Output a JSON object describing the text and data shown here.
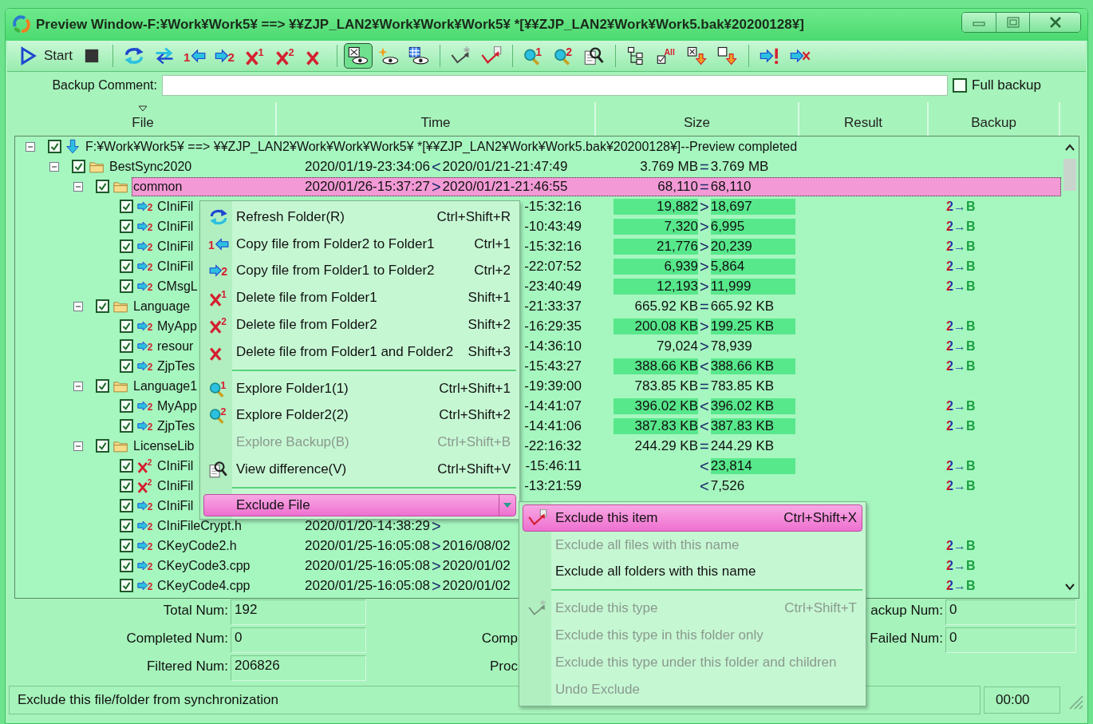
{
  "window": {
    "title": "Preview Window-F:¥Work¥Work5¥ ==> ¥¥ZJP_LAN2¥Work¥Work¥Work5¥ *[¥¥ZJP_LAN2¥Work¥Work5.bak¥20200128¥]"
  },
  "toolbar": [
    {
      "kind": "start",
      "label": "Start"
    },
    {
      "kind": "stop"
    },
    {
      "kind": "separator"
    },
    {
      "kind": "refresh"
    },
    {
      "kind": "sync"
    },
    {
      "kind": "copy_left",
      "badge": "1"
    },
    {
      "kind": "copy_right",
      "badge": "2"
    },
    {
      "kind": "delete",
      "badge": "1"
    },
    {
      "kind": "delete",
      "badge": "2"
    },
    {
      "kind": "delete"
    },
    {
      "kind": "separator"
    },
    {
      "kind": "view",
      "pressed": true
    },
    {
      "kind": "view_spark",
      "pressed": false
    },
    {
      "kind": "view_grid",
      "pressed": false
    },
    {
      "kind": "separator"
    },
    {
      "kind": "exclude_type"
    },
    {
      "kind": "exclude"
    },
    {
      "kind": "separator"
    },
    {
      "kind": "explore",
      "badge": "1"
    },
    {
      "kind": "explore",
      "badge": "2"
    },
    {
      "kind": "diff"
    },
    {
      "kind": "separator"
    },
    {
      "kind": "tree"
    },
    {
      "kind": "check_all",
      "badge": "All"
    },
    {
      "kind": "check_down"
    },
    {
      "kind": "uncheck_down"
    },
    {
      "kind": "separator"
    },
    {
      "kind": "arrow_alert"
    },
    {
      "kind": "arrow_cancel"
    }
  ],
  "backup_comment": {
    "label": "Backup Comment:",
    "full_backup": {
      "label": "Full backup",
      "checked": false
    }
  },
  "columns": [
    "File",
    "Time",
    "Size",
    "Result",
    "Backup"
  ],
  "tree": [
    {
      "kind": "root",
      "name": "F:¥Work¥Work5¥ ==> ¥¥ZJP_LAN2¥Work¥Work¥Work5¥ *[¥¥ZJP_LAN2¥Work¥Work5.bak¥20200128¥]--Preview completed",
      "checked": true,
      "expanded": true,
      "selected": false,
      "children": [
        {
          "kind": "folder",
          "name": "BestSync2020",
          "checked": true,
          "expanded": true,
          "selected": false,
          "time1": "2020/01/19-23:34:06",
          "time_cmp": "<",
          "time2": "2020/01/21-21:47:49",
          "size1": "3.769 MB",
          "size_cmp": "=",
          "size2": "3.769 MB",
          "highlight": false,
          "children": [
            {
              "kind": "folder",
              "name": "common",
              "checked": true,
              "expanded": true,
              "selected": true,
              "time1": "2020/01/26-15:37:27",
              "time_cmp": ">",
              "time2": "2020/01/21-21:46:55",
              "size1": "68,110",
              "size_cmp": "=",
              "size2": "68,110",
              "highlight": false,
              "children": [
                {
                  "kind": "copy",
                  "icon_badge": "2",
                  "name": "CIniFil",
                  "checked": true,
                  "selected": false,
                  "time2": "-15:32:16",
                  "size1": "19,882",
                  "size_cmp": ">",
                  "size2": "18,697",
                  "highlight": true,
                  "backup": "2→B"
                },
                {
                  "kind": "copy",
                  "icon_badge": "2",
                  "name": "CIniFil",
                  "checked": true,
                  "selected": false,
                  "time2": "-10:43:49",
                  "size1": "7,320",
                  "size_cmp": ">",
                  "size2": "6,995",
                  "highlight": true,
                  "backup": "2→B"
                },
                {
                  "kind": "copy",
                  "icon_badge": "2",
                  "name": "CIniFil",
                  "checked": true,
                  "selected": false,
                  "time2": "-15:32:16",
                  "size1": "21,776",
                  "size_cmp": ">",
                  "size2": "20,239",
                  "highlight": true,
                  "backup": "2→B"
                },
                {
                  "kind": "copy",
                  "icon_badge": "2",
                  "name": "CIniFil",
                  "checked": true,
                  "selected": false,
                  "time2": "-22:07:52",
                  "size1": "6,939",
                  "size_cmp": ">",
                  "size2": "5,864",
                  "highlight": true,
                  "backup": "2→B"
                },
                {
                  "kind": "copy",
                  "icon_badge": "2",
                  "name": "CMsgL",
                  "checked": true,
                  "selected": false,
                  "time2": "-23:40:49",
                  "size1": "12,193",
                  "size_cmp": ">",
                  "size2": "11,999",
                  "highlight": true,
                  "backup": "2→B"
                }
              ]
            },
            {
              "kind": "folder",
              "name": "Language",
              "checked": true,
              "expanded": true,
              "selected": false,
              "time2": "-21:33:37",
              "size1": "665.92 KB",
              "size_cmp": "=",
              "size2": "665.92 KB",
              "highlight": false,
              "children": [
                {
                  "kind": "copy",
                  "icon_badge": "2",
                  "name": "MyApp",
                  "checked": true,
                  "selected": false,
                  "time2": "-16:29:35",
                  "size1": "200.08 KB",
                  "size_cmp": ">",
                  "size2": "199.25 KB",
                  "highlight": true,
                  "backup": "2→B"
                },
                {
                  "kind": "copy",
                  "icon_badge": "2",
                  "name": "resour",
                  "checked": true,
                  "selected": false,
                  "time2": "-14:36:10",
                  "size1": "79,024",
                  "size_cmp": ">",
                  "size2": "78,939",
                  "highlight": false,
                  "backup": "2→B"
                },
                {
                  "kind": "copy",
                  "icon_badge": "2",
                  "name": "ZjpTes",
                  "checked": true,
                  "selected": false,
                  "time2": "-15:43:27",
                  "size1": "388.66 KB",
                  "size_cmp": "<",
                  "size2": "388.66 KB",
                  "highlight": true,
                  "backup": "2→B"
                }
              ]
            },
            {
              "kind": "folder",
              "name": "Language1",
              "checked": true,
              "expanded": true,
              "selected": false,
              "time2": "-19:39:00",
              "size1": "783.85 KB",
              "size_cmp": "=",
              "size2": "783.85 KB",
              "highlight": false,
              "children": [
                {
                  "kind": "copy",
                  "icon_badge": "2",
                  "name": "MyApp",
                  "checked": true,
                  "selected": false,
                  "time2": "-14:41:07",
                  "size1": "396.02 KB",
                  "size_cmp": "<",
                  "size2": "396.02 KB",
                  "highlight": true,
                  "backup": "2→B"
                },
                {
                  "kind": "copy",
                  "icon_badge": "2",
                  "name": "ZjpTes",
                  "checked": true,
                  "selected": false,
                  "time2": "-14:41:06",
                  "size1": "387.83 KB",
                  "size_cmp": "<",
                  "size2": "387.83 KB",
                  "highlight": true,
                  "backup": "2→B"
                }
              ]
            },
            {
              "kind": "folder",
              "name": "LicenseLib",
              "checked": true,
              "expanded": true,
              "selected": false,
              "time2": "-22:16:32",
              "size1": "244.29 KB",
              "size_cmp": "=",
              "size2": "244.29 KB",
              "highlight": false,
              "children": [
                {
                  "kind": "delete",
                  "icon_badge": "2",
                  "name": "CIniFil",
                  "checked": true,
                  "selected": false,
                  "time2": "-15:46:11",
                  "size_cmp": "<",
                  "size2": "23,814",
                  "highlight": true,
                  "backup": "2→B"
                },
                {
                  "kind": "delete",
                  "icon_badge": "2",
                  "name": "CIniFil",
                  "checked": true,
                  "selected": false,
                  "time2": "-13:21:59",
                  "size_cmp": "<",
                  "size2": "7,526",
                  "highlight": false,
                  "backup": "2→B"
                },
                {
                  "kind": "copy",
                  "icon_badge": "2",
                  "name": "CIniFil",
                  "checked": true,
                  "selected": false
                },
                {
                  "kind": "copy",
                  "icon_badge": "2",
                  "name": "CIniFileCrypt.h",
                  "checked": true,
                  "selected": false,
                  "time1": "2020/01/20-14:38:29",
                  "time_cmp": ">"
                },
                {
                  "kind": "copy",
                  "icon_badge": "2",
                  "name": "CKeyCode2.h",
                  "checked": true,
                  "selected": false,
                  "time1": "2020/01/25-16:05:08",
                  "time_cmp": ">",
                  "time2": "2016/08/02",
                  "backup": "2→B"
                },
                {
                  "kind": "copy",
                  "icon_badge": "2",
                  "name": "CKeyCode3.cpp",
                  "checked": true,
                  "selected": false,
                  "time1": "2020/01/25-16:05:08",
                  "time_cmp": ">",
                  "time2": "2020/01/02",
                  "backup": "2→B"
                },
                {
                  "kind": "copy",
                  "icon_badge": "2",
                  "name": "CKeyCode4.cpp",
                  "checked": true,
                  "selected": false,
                  "time1": "2020/01/25-16:05:08",
                  "time_cmp": ">",
                  "time2": "2020/01/02",
                  "backup": "2→B"
                }
              ]
            }
          ]
        }
      ]
    }
  ],
  "stats": [
    {
      "left": {
        "label": "Total Num:",
        "value": "192"
      },
      "right": {
        "label": "ackup Num:",
        "value": "0"
      }
    },
    {
      "left": {
        "label": "Completed Num:",
        "value": "0"
      },
      "middle": {
        "label": "Comp"
      },
      "right": {
        "label": "Failed Num:",
        "value": "0"
      }
    },
    {
      "left": {
        "label": "Filtered Num:",
        "value": "206826"
      },
      "middle": {
        "label": "Proc"
      }
    }
  ],
  "status_bar": {
    "message": "Exclude this file/folder from synchronization",
    "time": "00:00"
  },
  "context_menu": {
    "items": [
      {
        "kind": "refresh",
        "label": "Refresh Folder(R)",
        "shortcut": "Ctrl+Shift+R",
        "disabled": false,
        "selected": false
      },
      {
        "kind": "copy_left",
        "icon_badge": "1",
        "label": "Copy file from Folder2 to Folder1",
        "shortcut": "Ctrl+1",
        "disabled": false,
        "selected": false
      },
      {
        "kind": "copy_right",
        "icon_badge": "2",
        "label": "Copy file from Folder1 to Folder2",
        "shortcut": "Ctrl+2",
        "disabled": false,
        "selected": false
      },
      {
        "kind": "delete",
        "icon_badge": "1",
        "label": "Delete file from Folder1",
        "shortcut": "Shift+1",
        "disabled": false,
        "selected": false
      },
      {
        "kind": "delete",
        "icon_badge": "2",
        "label": "Delete file from Folder2",
        "shortcut": "Shift+2",
        "disabled": false,
        "selected": false
      },
      {
        "kind": "delete",
        "label": "Delete file from Folder1 and Folder2",
        "shortcut": "Shift+3",
        "disabled": false,
        "selected": false
      },
      {
        "kind": "separator"
      },
      {
        "kind": "explore",
        "icon_badge": "1",
        "label": "Explore Folder1(1)",
        "shortcut": "Ctrl+Shift+1",
        "disabled": false,
        "selected": false
      },
      {
        "kind": "explore",
        "icon_badge": "2",
        "label": "Explore Folder2(2)",
        "shortcut": "Ctrl+Shift+2",
        "disabled": false,
        "selected": false
      },
      {
        "kind": "plain",
        "label": "Explore Backup(B)",
        "shortcut": "Ctrl+Shift+B",
        "disabled": true,
        "selected": false
      },
      {
        "kind": "diff",
        "label": "View difference(V)",
        "shortcut": "Ctrl+Shift+V",
        "disabled": false,
        "selected": false
      },
      {
        "kind": "separator"
      },
      {
        "kind": "submenu",
        "label": "Exclude File",
        "selected": true
      }
    ]
  },
  "submenu": {
    "items": [
      {
        "kind": "exclude",
        "label": "Exclude this item",
        "shortcut": "Ctrl+Shift+X",
        "disabled": false,
        "selected": true
      },
      {
        "kind": "plain",
        "label": "Exclude all files with this name",
        "disabled": true,
        "selected": false
      },
      {
        "kind": "plain",
        "label": "Exclude all folders with this name",
        "disabled": false,
        "selected": false
      },
      {
        "kind": "separator"
      },
      {
        "kind": "exclude_type",
        "label": "Exclude this type",
        "shortcut": "Ctrl+Shift+T",
        "disabled": true,
        "selected": false
      },
      {
        "kind": "plain",
        "label": "Exclude this type in this folder only",
        "disabled": true,
        "selected": false
      },
      {
        "kind": "plain",
        "label": "Exclude this type under this folder and children",
        "disabled": true,
        "selected": false
      },
      {
        "kind": "plain",
        "label": "Undo Exclude",
        "disabled": true,
        "selected": false
      }
    ]
  }
}
